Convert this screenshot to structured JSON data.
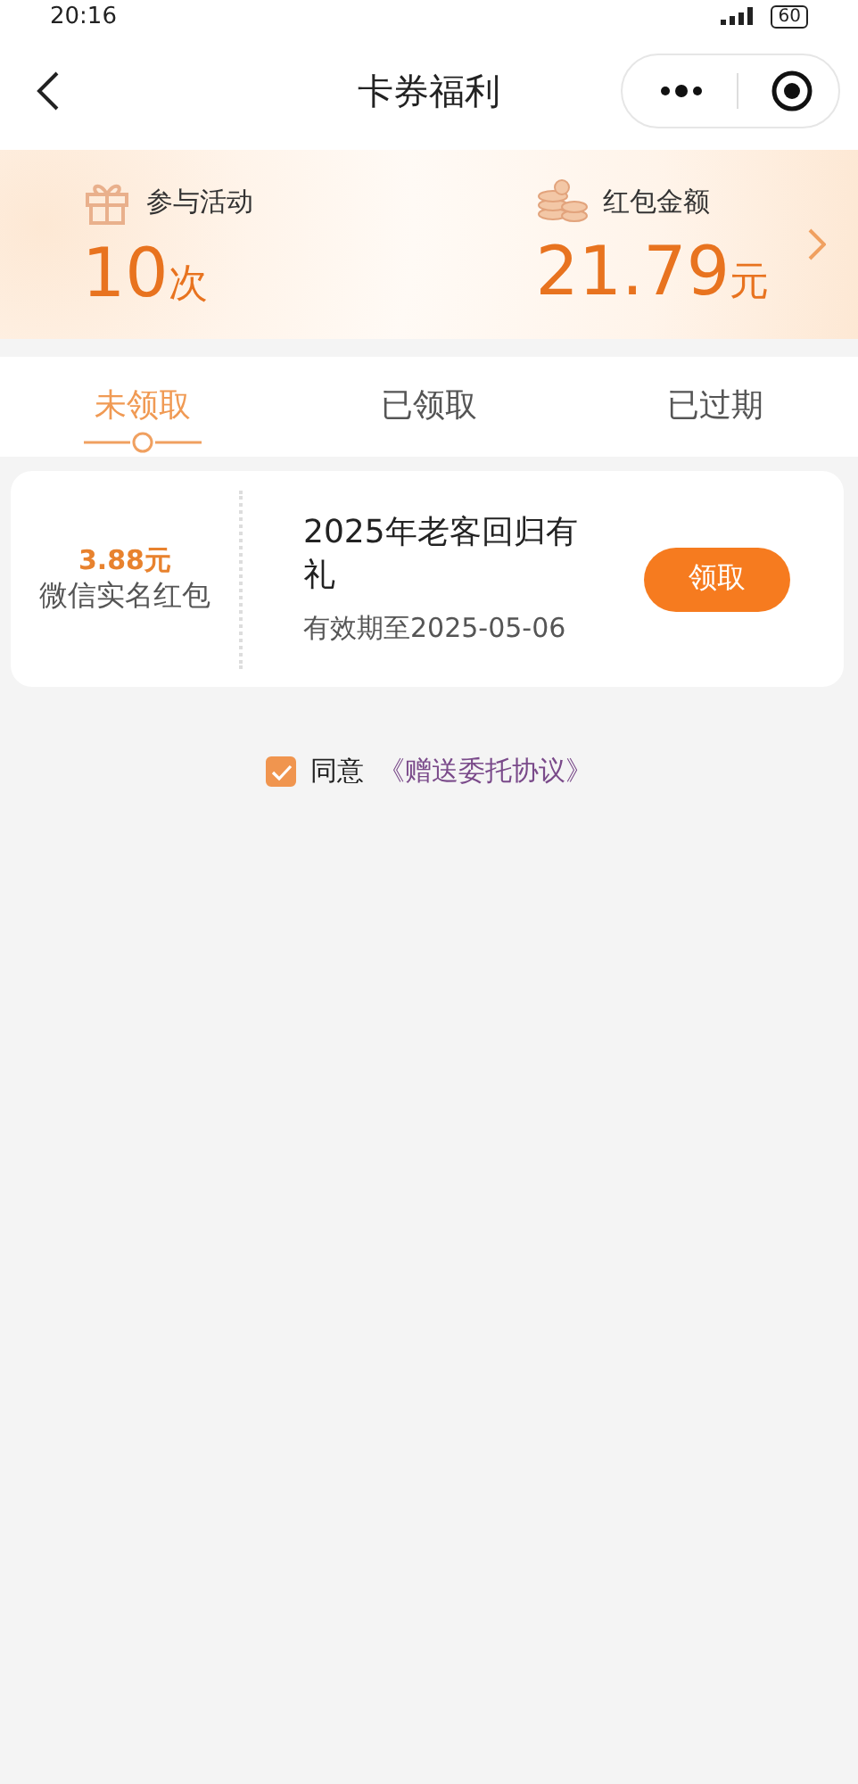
{
  "status_bar": {
    "time": "20:16",
    "battery": "60"
  },
  "nav": {
    "title": "卡券福利"
  },
  "summary": {
    "items": [
      {
        "kind": "gift",
        "label": "参与活动",
        "value": "10",
        "unit": "次"
      },
      {
        "kind": "coins",
        "label": "红包金额",
        "value": "21.79",
        "unit": "元"
      }
    ]
  },
  "tabs": [
    {
      "label": "未领取",
      "selected": true
    },
    {
      "label": "已领取",
      "selected": false
    },
    {
      "label": "已过期",
      "selected": false
    }
  ],
  "coupons": [
    {
      "amount": "3.88元",
      "type": "微信实名红包",
      "title": "2025年老客回归有礼",
      "validity": "有效期至2025-05-06",
      "action": "领取"
    }
  ],
  "agreement": {
    "checked": true,
    "text": "同意",
    "link": "《赠送委托协议》"
  }
}
